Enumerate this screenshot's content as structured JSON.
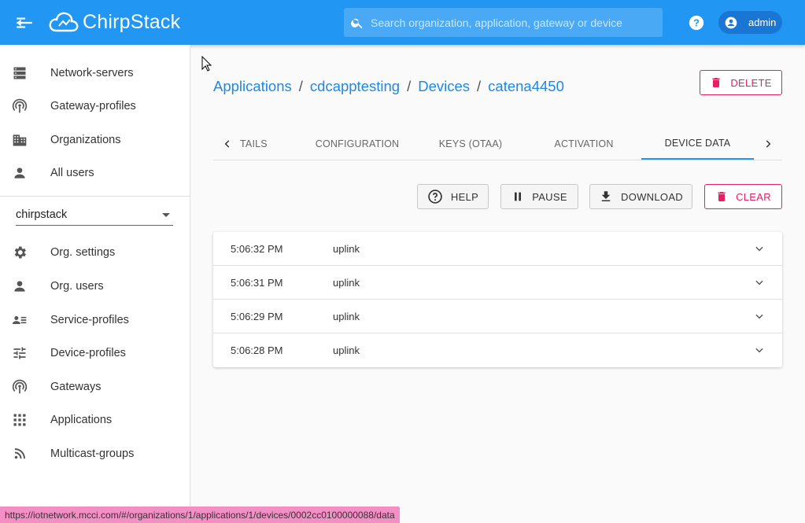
{
  "app": {
    "name": "ChirpStack"
  },
  "search": {
    "placeholder": "Search organization, application, gateway or device"
  },
  "user": {
    "name": "admin"
  },
  "sidebar": {
    "global_items": [
      {
        "label": "Network-servers",
        "icon": "server-icon"
      },
      {
        "label": "Gateway-profiles",
        "icon": "antenna-icon"
      },
      {
        "label": "Organizations",
        "icon": "domain-icon"
      },
      {
        "label": "All users",
        "icon": "person-icon"
      }
    ],
    "org_selector": {
      "value": "chirpstack"
    },
    "org_items": [
      {
        "label": "Org. settings",
        "icon": "gear-icon"
      },
      {
        "label": "Org. users",
        "icon": "person-icon"
      },
      {
        "label": "Service-profiles",
        "icon": "account-details-icon"
      },
      {
        "label": "Device-profiles",
        "icon": "tune-icon"
      },
      {
        "label": "Gateways",
        "icon": "antenna-icon"
      },
      {
        "label": "Applications",
        "icon": "apps-grid-icon"
      },
      {
        "label": "Multicast-groups",
        "icon": "rss-icon"
      }
    ]
  },
  "breadcrumb": {
    "items": [
      "Applications",
      "cdcapptesting",
      "Devices",
      "catena4450"
    ],
    "separator": "/"
  },
  "actions": {
    "delete_label": "DELETE"
  },
  "tabs": {
    "items": [
      "TAILS",
      "CONFIGURATION",
      "KEYS (OTAA)",
      "ACTIVATION",
      "DEVICE DATA"
    ],
    "active": "DEVICE DATA"
  },
  "toolbar": {
    "help_label": "HELP",
    "pause_label": "PAUSE",
    "download_label": "DOWNLOAD",
    "clear_label": "CLEAR"
  },
  "device_data": {
    "rows": [
      {
        "time": "5:06:32 PM",
        "type": "uplink"
      },
      {
        "time": "5:06:31 PM",
        "type": "uplink"
      },
      {
        "time": "5:06:29 PM",
        "type": "uplink"
      },
      {
        "time": "5:06:28 PM",
        "type": "uplink"
      }
    ]
  },
  "status_bar": {
    "url": "https://iotnetwork.mcci.com/#/organizations/1/applications/1/devices/0002cc0100000088/data"
  },
  "colors": {
    "primary": "#2196f3",
    "danger": "#e91e63",
    "status_bar": "#f48fc5"
  }
}
